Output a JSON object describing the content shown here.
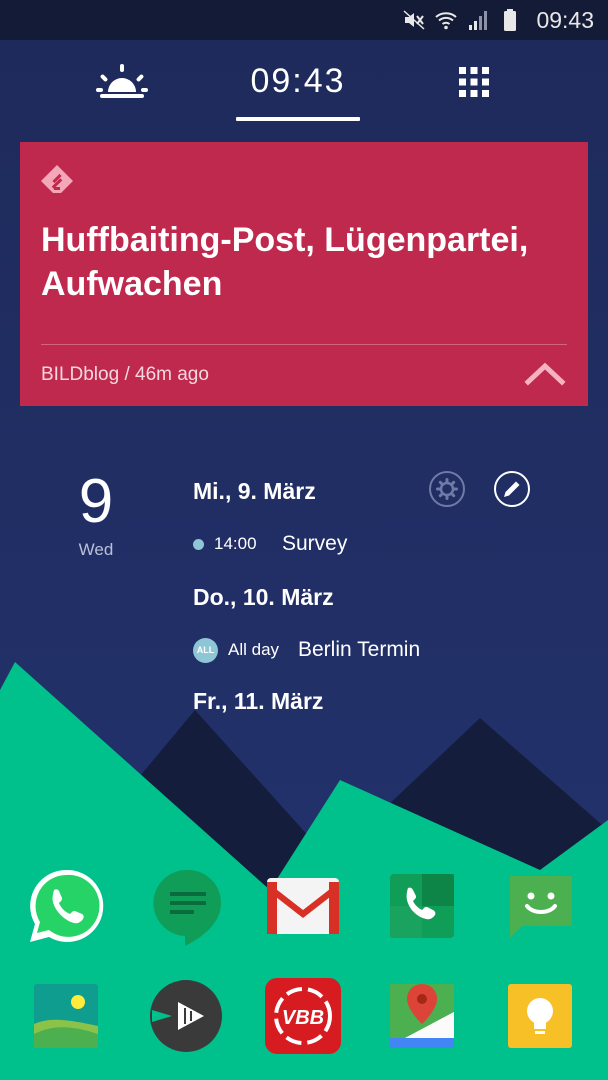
{
  "status_bar": {
    "time": "09:43",
    "icons": [
      "mute-icon",
      "wifi-icon",
      "signal-icon",
      "battery-icon"
    ]
  },
  "top_nav": {
    "left_icon": "sunrise-icon",
    "clock": "09:43",
    "right_icon": "app-grid-icon"
  },
  "feed_card": {
    "icon": "feedly-icon",
    "title": "Huffbaiting-Post, Lügenpartei, Aufwachen",
    "meta": "BILDblog / 46m ago",
    "action_icon": "chevron-up-icon",
    "color": "#c0294e"
  },
  "calendar": {
    "day_number": "9",
    "day_name": "Wed",
    "days": [
      {
        "header": "Mi., 9. März",
        "events": [
          {
            "time": "14:00",
            "title": "Survey"
          }
        ]
      },
      {
        "header": "Do., 10. März",
        "events": [
          {
            "badge": "ALL",
            "time": "All day",
            "title": "Berlin Termin"
          }
        ]
      },
      {
        "header": "Fr., 11. März",
        "events": []
      }
    ],
    "event_color": "#8ec6d6"
  },
  "apps": {
    "row1": [
      "whatsapp-icon",
      "hangouts-icon",
      "gmail-icon",
      "phone-icon",
      "messages-icon"
    ],
    "row2": [
      "gallery-icon",
      "music-player-icon",
      "vbb-icon",
      "maps-icon",
      "keep-icon"
    ],
    "vbb_label": "VBB"
  },
  "colors": {
    "sky": "#1f2c5e",
    "mountain_dark": "#151d3d",
    "mountain_green": "#00c08b",
    "status_bar": "#141b36"
  }
}
